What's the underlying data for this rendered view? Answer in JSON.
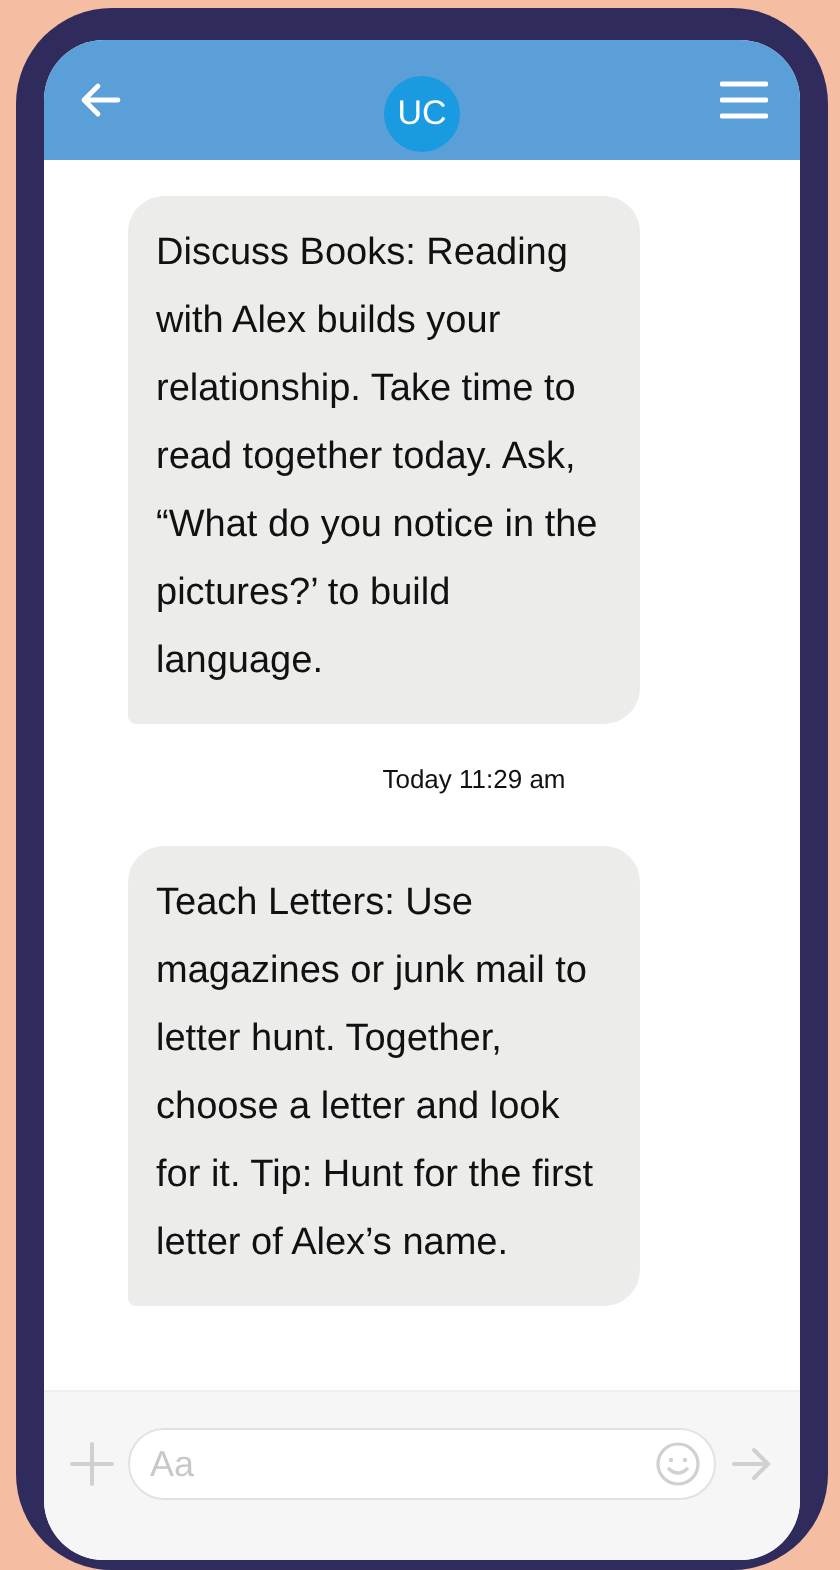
{
  "header": {
    "avatar": "UC"
  },
  "thread": [
    {
      "kind": "message",
      "text": "Discuss Books: Reading with Alex builds your relationship. Take time to read together today. Ask, “What do you notice in the pictures?’ to build language."
    },
    {
      "kind": "timestamp",
      "text": "Today 11:29 am"
    },
    {
      "kind": "message",
      "text": "Teach Letters: Use magazines or junk mail to letter hunt. Together, choose a letter and look for it. Tip: Hunt for the first letter of Alex’s name."
    }
  ],
  "composer": {
    "placeholder": "Aa"
  }
}
